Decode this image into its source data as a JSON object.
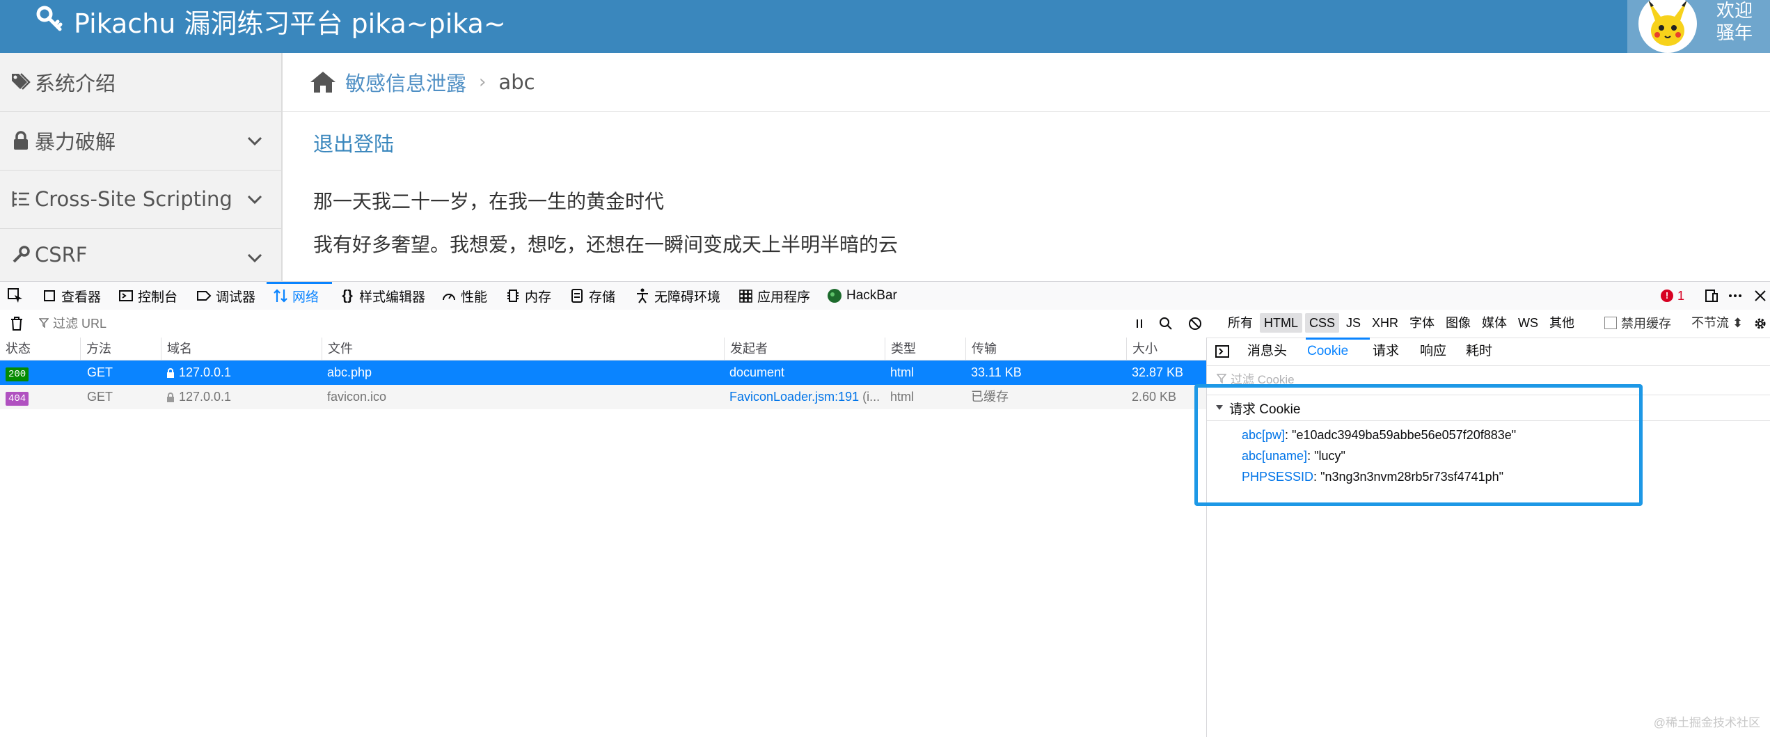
{
  "header": {
    "title": "Pikachu 漏洞练习平台 pika~pika~",
    "logo_icon": "key-icon",
    "welcome_line1": "欢迎",
    "welcome_line2": "骚年",
    "avatar_icon": "pikachu-avatar"
  },
  "sidebar": {
    "items": [
      {
        "label": "系统介绍",
        "icon": "tags-icon"
      },
      {
        "label": "暴力破解",
        "icon": "lock-icon"
      },
      {
        "label": "Cross-Site Scripting",
        "icon": "list-icon"
      },
      {
        "label": "CSRF",
        "icon": "wrench-icon"
      }
    ]
  },
  "breadcrumb": {
    "link": "敏感信息泄露",
    "current": "abc"
  },
  "main": {
    "logout": "退出登陆",
    "lines": [
      "那一天我二十一岁，在我一生的黄金时代",
      "我有好多奢望。我想爱，想吃，还想在一瞬间变成天上半明半暗的云"
    ]
  },
  "devtools": {
    "tabs": [
      {
        "label": "查看器",
        "icon": "inspector-icon"
      },
      {
        "label": "控制台",
        "icon": "console-icon"
      },
      {
        "label": "调试器",
        "icon": "debugger-icon"
      },
      {
        "label": "网络",
        "icon": "network-icon"
      },
      {
        "label": "样式编辑器",
        "icon": "style-editor-icon"
      },
      {
        "label": "性能",
        "icon": "performance-icon"
      },
      {
        "label": "内存",
        "icon": "memory-icon"
      },
      {
        "label": "存储",
        "icon": "storage-icon"
      },
      {
        "label": "无障碍环境",
        "icon": "accessibility-icon"
      },
      {
        "label": "应用程序",
        "icon": "application-icon"
      },
      {
        "label": "HackBar",
        "icon": "hackbar-icon"
      }
    ],
    "error_count": "1",
    "filter_placeholder": "过滤 URL",
    "type_filters": [
      "所有",
      "HTML",
      "CSS",
      "JS",
      "XHR",
      "字体",
      "图像",
      "媒体",
      "WS",
      "其他"
    ],
    "disable_cache": "禁用缓存",
    "throttle": "不节流 ⬍",
    "columns": [
      "状态",
      "方法",
      "域名",
      "文件",
      "发起者",
      "类型",
      "传输",
      "大小"
    ],
    "rows": [
      {
        "status": "200",
        "method": "GET",
        "domain": "127.0.0.1",
        "file": "abc.php",
        "initiator": "document",
        "initiator_extra": "",
        "type": "html",
        "transfer": "33.11 KB",
        "size": "32.87 KB"
      },
      {
        "status": "404",
        "method": "GET",
        "domain": "127.0.0.1",
        "file": "favicon.ico",
        "initiator": "FaviconLoader.jsm:191",
        "initiator_extra": "(i...",
        "type": "html",
        "transfer": "已缓存",
        "size": "2.60 KB"
      }
    ],
    "panel_tabs": [
      "消息头",
      "Cookie",
      "请求",
      "响应",
      "耗时"
    ],
    "cookie_filter": "过滤 Cookie",
    "cookie_section": "请求 Cookie",
    "cookies": [
      {
        "key": "abc[pw]",
        "value": "\"e10adc3949ba59abbe56e057f20f883e\""
      },
      {
        "key": "abc[uname]",
        "value": "\"lucy\""
      },
      {
        "key": "PHPSESSID",
        "value": "\"n3ng3n3nvm28rb5r73sf4741ph\""
      }
    ],
    "watermark": "@稀土掘金技术社区",
    "colors": {
      "accent": "#0a84ff",
      "status_200": "#058b00",
      "status_404": "#b051c0",
      "highlight": "#1d98e6"
    }
  }
}
